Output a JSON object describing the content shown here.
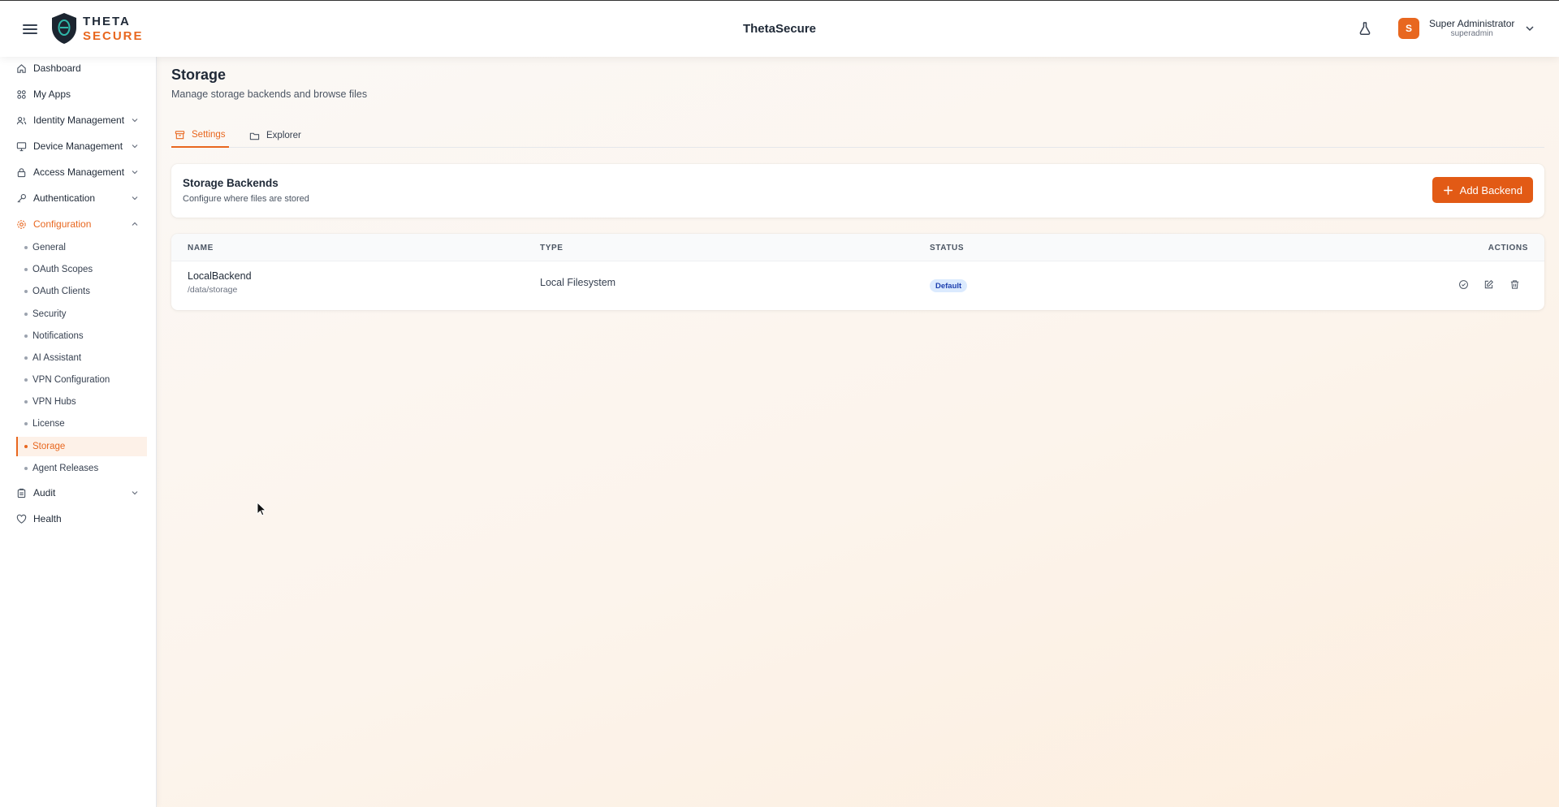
{
  "header": {
    "logo_line1": "THETA",
    "logo_line2": "SECURE",
    "app_title": "ThetaSecure",
    "user": {
      "initial": "S",
      "name": "Super Administrator",
      "username": "superadmin"
    }
  },
  "sidebar": {
    "items": [
      {
        "label": "Dashboard"
      },
      {
        "label": "My Apps"
      },
      {
        "label": "Identity Management"
      },
      {
        "label": "Device Management"
      },
      {
        "label": "Access Management"
      },
      {
        "label": "Authentication"
      },
      {
        "label": "Configuration"
      }
    ],
    "sub_items": [
      {
        "label": "General"
      },
      {
        "label": "OAuth Scopes"
      },
      {
        "label": "OAuth Clients"
      },
      {
        "label": "Security"
      },
      {
        "label": "Notifications"
      },
      {
        "label": "AI Assistant"
      },
      {
        "label": "VPN Configuration"
      },
      {
        "label": "VPN Hubs"
      },
      {
        "label": "License"
      },
      {
        "label": "Storage"
      },
      {
        "label": "Agent Releases"
      }
    ],
    "bottom_items": [
      {
        "label": "Audit"
      },
      {
        "label": "Health"
      }
    ]
  },
  "page": {
    "title": "Storage",
    "subtitle": "Manage storage backends and browse files",
    "tabs": [
      {
        "label": "Settings"
      },
      {
        "label": "Explorer"
      }
    ]
  },
  "backends": {
    "title": "Storage Backends",
    "subtitle": "Configure where files are stored",
    "add_label": "Add Backend"
  },
  "table": {
    "headers": {
      "name": "NAME",
      "type": "TYPE",
      "status": "STATUS",
      "actions": "ACTIONS"
    },
    "rows": [
      {
        "name": "LocalBackend",
        "path": "/data/storage",
        "type": "Local Filesystem",
        "status": "Default"
      }
    ]
  },
  "colors": {
    "accent": "#e8671f",
    "badge_bg": "#dbeafe",
    "badge_text": "#1e40af"
  }
}
